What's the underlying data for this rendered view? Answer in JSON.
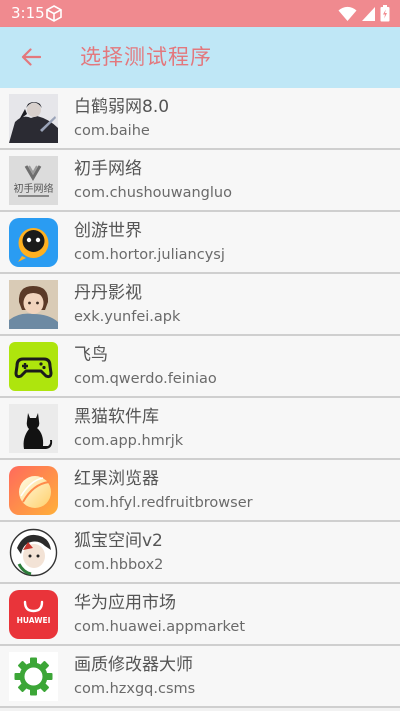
{
  "status_bar": {
    "time": "3:15",
    "color": "#f08a8f"
  },
  "header": {
    "title": "选择测试程序",
    "back_icon": "arrow-left-icon",
    "background": "#bfe7f6",
    "title_color": "#e3787d"
  },
  "apps": [
    {
      "name": "白鹤弱网8.0",
      "package": "com.baihe",
      "icon": "baihe-app-icon"
    },
    {
      "name": "初手网络",
      "package": "com.chushouwangluo",
      "icon": "chushou-app-icon",
      "icon_text": "初手网络"
    },
    {
      "name": "创游世界",
      "package": "com.hortor.juliancysj",
      "icon": "chuangyou-app-icon"
    },
    {
      "name": "丹丹影视",
      "package": "exk.yunfei.apk",
      "icon": "dandan-app-icon"
    },
    {
      "name": "飞鸟",
      "package": "com.qwerdo.feiniao",
      "icon": "feiniao-app-icon"
    },
    {
      "name": "黑猫软件库",
      "package": "com.app.hmrjk",
      "icon": "heimao-app-icon"
    },
    {
      "name": "红果浏览器",
      "package": "com.hfyl.redfruitbrowser",
      "icon": "hongguo-app-icon"
    },
    {
      "name": "狐宝空间v2",
      "package": "com.hbbox2",
      "icon": "hubao-app-icon"
    },
    {
      "name": "华为应用市场",
      "package": "com.huawei.appmarket",
      "icon": "huawei-app-icon",
      "icon_text": "HUAWEI"
    },
    {
      "name": "画质修改器大师",
      "package": "com.hzxgq.csms",
      "icon": "huazhi-app-icon"
    }
  ]
}
